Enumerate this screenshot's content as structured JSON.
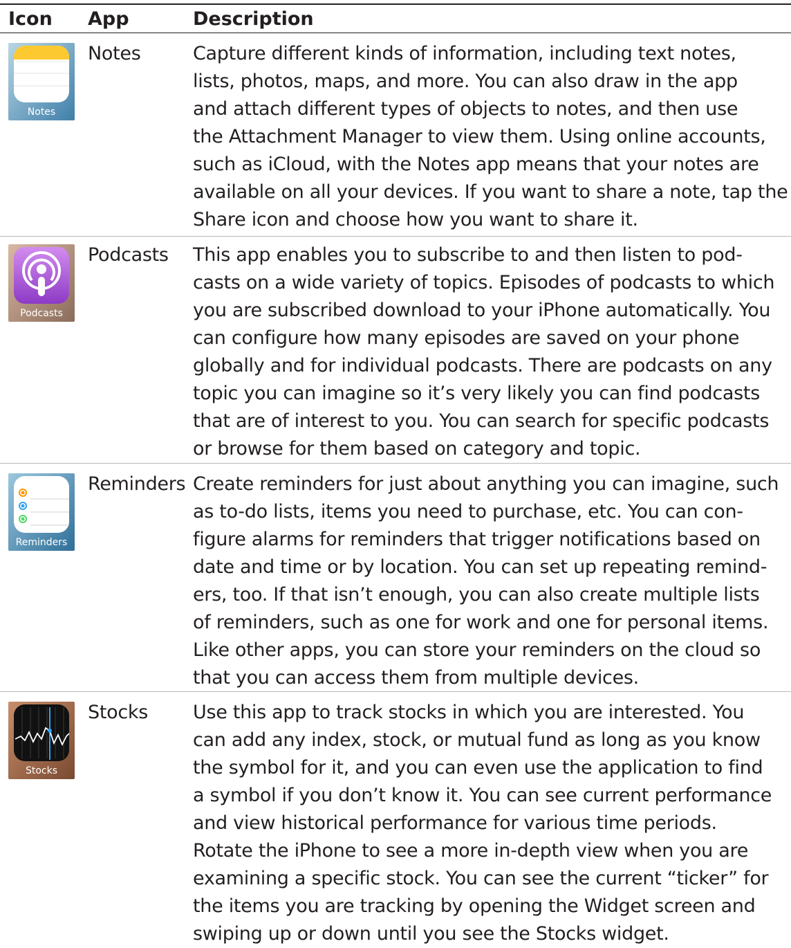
{
  "table": {
    "headers": {
      "icon": "Icon",
      "app": "App",
      "description": "Description"
    },
    "rows": [
      {
        "app": "Notes",
        "icon_name": "notes-app-icon",
        "icon_label": "Notes",
        "lines": [
          "Capture different kinds of information, including text notes,",
          "lists, photos, maps, and more. You can also draw in the app",
          "and attach different types of objects to notes, and then use",
          "the Attachment Manager to view them. Using online accounts,",
          "such as iCloud, with the Notes app means that your notes are",
          "available on all your devices. If you want to share a note, tap the",
          "Share icon and choose how you want to share it."
        ]
      },
      {
        "app": "Podcasts",
        "icon_name": "podcasts-app-icon",
        "icon_label": "Podcasts",
        "lines": [
          "This app enables you to subscribe to and then listen to pod-",
          "casts on a wide variety of topics. Episodes of podcasts to which",
          "you are subscribed download to your iPhone automatically. You",
          "can configure how many episodes are saved on your phone",
          "globally and for individual podcasts. There are podcasts on any",
          "topic you can imagine so it’s very likely you can find podcasts",
          "that are of interest to you. You can search for specific podcasts",
          "or browse for them based on category and topic."
        ]
      },
      {
        "app": "Reminders",
        "icon_name": "reminders-app-icon",
        "icon_label": "Reminders",
        "lines": [
          "Create reminders for just about anything you can imagine, such",
          "as to-do lists, items you need to purchase, etc. You can con-",
          "figure alarms for reminders that trigger notifications based on",
          "date and time or by location. You can set up repeating remind-",
          "ers, too. If that isn’t enough, you can also create multiple lists",
          "of reminders, such as one for work and one for personal items.",
          "Like other apps, you can store your reminders on the cloud so",
          "that you can access them from multiple devices."
        ]
      },
      {
        "app": "Stocks",
        "icon_name": "stocks-app-icon",
        "icon_label": "Stocks",
        "lines": [
          "Use this app to track stocks in which you are interested. You",
          "can add any index, stock, or mutual fund as long as you know",
          "the symbol for it, and you can even use the application to find",
          "a symbol if you don’t know it. You can see current performance",
          "and view historical performance for various time periods.",
          "Rotate the iPhone to see a more in-depth view when you are",
          "examining a specific stock. You can see the current “ticker” for",
          "the items you are tracking by opening the Widget screen and",
          "swiping up or down until you see the Stocks widget."
        ]
      }
    ]
  }
}
